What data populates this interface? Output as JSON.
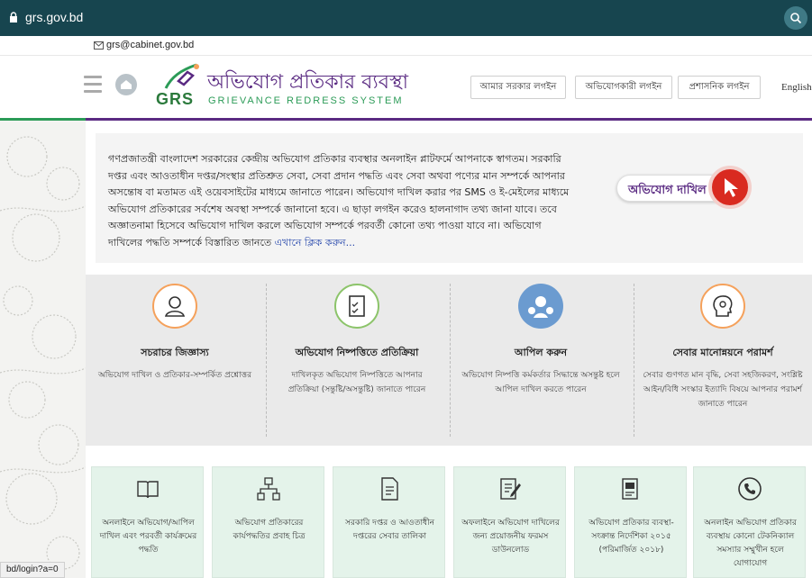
{
  "browser": {
    "url": "grs.gov.bd"
  },
  "header": {
    "email": "grs@cabinet.gov.bd",
    "logo_title": "অভিযোগ প্রতিকার ব্যবস্থা",
    "logo_abbr": "GRS",
    "logo_subtitle": "GRIEVANCE REDRESS SYSTEM",
    "login_buttons": [
      "আমার সরকার লগইন",
      "অভিযোগকারী লগইন",
      "প্রশাসনিক লগইন"
    ],
    "language": "English"
  },
  "intro": {
    "text": "গণপ্রজাতন্ত্রী বাংলাদেশ সরকারের কেন্দ্রীয় অভিযোগ প্রতিকার ব্যবস্থার অনলাইন প্লাটফর্মে আপনাকে স্বাগতম। সরকারি দপ্তর এবং আওতাধীন দপ্তর/সংস্থার প্রতিশ্রুত সেবা, সেবা প্রদান পদ্ধতি এবং সেবা অথবা পণ্যের মান সম্পর্কে আপনার অসন্তোষ বা মতামত এই ওয়েবসাইটের মাধ্যমে জানাতে পারেন। অভিযোগ দাখিল করার পর SMS ও ই-মেইলের মাধ্যমে অভিযোগ প্রতিকারের সর্বশেষ অবস্থা সম্পর্কে জানানো হবে। এ ছাড়া লগইন করেও হালনাগাদ তথ্য জানা যাবে। তবে অজ্ঞাতনামা হিসেবে অভিযোগ দাখিল করলে অভিযোগ সম্পর্কে পরবর্তী কোনো তথ্য পাওয়া যাবে না। অভিযোগ দাখিলের পদ্ধতি সম্পর্কে বিস্তারিত জানতে ",
    "link_text": "এখানে ক্লিক করুন...",
    "complaint_button": "অভিযোগ দাখিল"
  },
  "services": [
    {
      "title": "সচরাচর জিজ্ঞাস্য",
      "desc": "অভিযোগ দাখিল ও প্রতিকার-সম্পর্কিত প্রশ্নোত্তর",
      "icon": "user-question-icon",
      "color": "#f5a15b"
    },
    {
      "title": "অভিযোগ নিষ্পত্তিতে প্রতিক্রিয়া",
      "desc": "দাখিলকৃত অভিযোগ নিষ্পত্তিতে আপনার প্রতিক্রিয়া (সন্তুষ্টি/অসন্তুষ্টি) জানাতে পারেন",
      "icon": "clipboard-check-icon",
      "color": "#8cc46a"
    },
    {
      "title": "আপিল করুন",
      "desc": "অভিযোগ নিষ্পত্তি কর্মকর্তার সিদ্ধান্তে অসন্তুষ্ট হলে আপিল দাখিল করতে পারেন",
      "icon": "people-appeal-icon",
      "color": "#6b9bd0"
    },
    {
      "title": "সেবার মানোন্নয়নে পরামর্শ",
      "desc": "সেবার গুণগত মান বৃদ্ধি, সেবা সহজিকরণ, সংশ্লিষ্ট আইন/বিধি সংস্কার ইত্যাদি বিষয়ে আপনার পরামর্শ জানাতে পারেন",
      "icon": "head-idea-icon",
      "color": "#f5a15b"
    }
  ],
  "links": [
    {
      "text": "অনলাইনে অভিযোগ/আপিল দাখিল এবং পরবর্তী কার্যক্রমের পদ্ধতি",
      "icon": "book-icon"
    },
    {
      "text": "অভিযোগ প্রতিকারের কার্যপদ্ধতির প্রবাহ চিত্র",
      "icon": "flowchart-icon"
    },
    {
      "text": "সরকারি দপ্তর ও আওতাধীন দপ্তরের সেবার তালিকা",
      "icon": "document-list-icon"
    },
    {
      "text": "অফলাইনে অভিযোগ দাখিলের জন্য প্রয়োজনীয় ফরমস ডাউনলোড",
      "icon": "form-edit-icon"
    },
    {
      "text": "অভিযোগ প্রতিকার ব্যবস্থা-সংক্রান্ত নির্দেশিকা ২০১৫ (পরিমার্জিত ২০১৮)",
      "icon": "guideline-doc-icon"
    },
    {
      "text": "অনলাইন অভিযোগ প্রতিকার ব্যবস্থায় কোনো টেকনিক্যাল সমস্যার সম্মুখীন হলে যোগাযোগ",
      "icon": "phone-icon"
    }
  ],
  "status_url": "bd/login?a=0"
}
